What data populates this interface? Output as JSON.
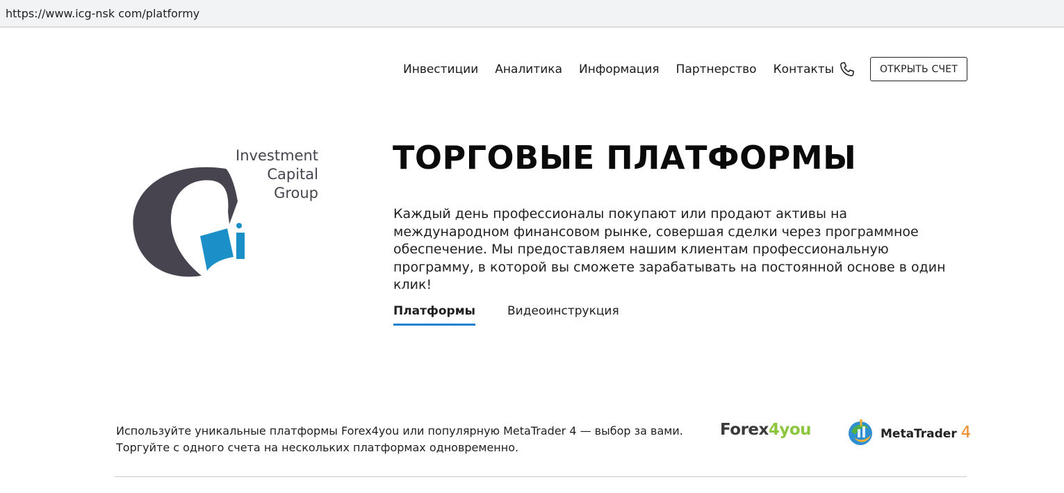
{
  "browser": {
    "url": "https://www.icg-nsk com/platformy"
  },
  "nav": {
    "items": [
      "Инвестиции",
      "Аналитика",
      "Информация",
      "Партнерство",
      "Контакты"
    ],
    "open_account": "ОТКРЫТЬ СЧЕТ"
  },
  "logo": {
    "lines": [
      "Investment",
      "Capital",
      "Group"
    ]
  },
  "main": {
    "title": "ТОРГОВЫЕ ПЛАТФОРМЫ",
    "description": "Каждый день профессионалы покупают или продают активы на международном финансовом рынке, совершая сделки через программное обеспечение. Мы предоставляем нашим клиентам профессиональную программу, в которой вы сможете зарабатывать на постоянной основе в один клик!",
    "tabs": [
      {
        "label": "Платформы",
        "active": true
      },
      {
        "label": "Видеоинструкция",
        "active": false
      }
    ]
  },
  "platforms": {
    "line1": "Используйте уникальные платформы Forex4you или популярную MetaTrader 4 — выбор за вами.",
    "line2": "Торгуйте с одного счета на нескольких платформах одновременно.",
    "forex": {
      "prefix": "Forex",
      "digit": "4",
      "suffix": "you"
    },
    "metatrader": {
      "name": "MetaTrader",
      "version": "4"
    }
  },
  "colors": {
    "logo_dark": "#47444f",
    "logo_blue": "#1a8fc8",
    "tab_accent": "#1f7fd1",
    "forex_green": "#8cc63f",
    "mt_orange": "#f08a25"
  }
}
